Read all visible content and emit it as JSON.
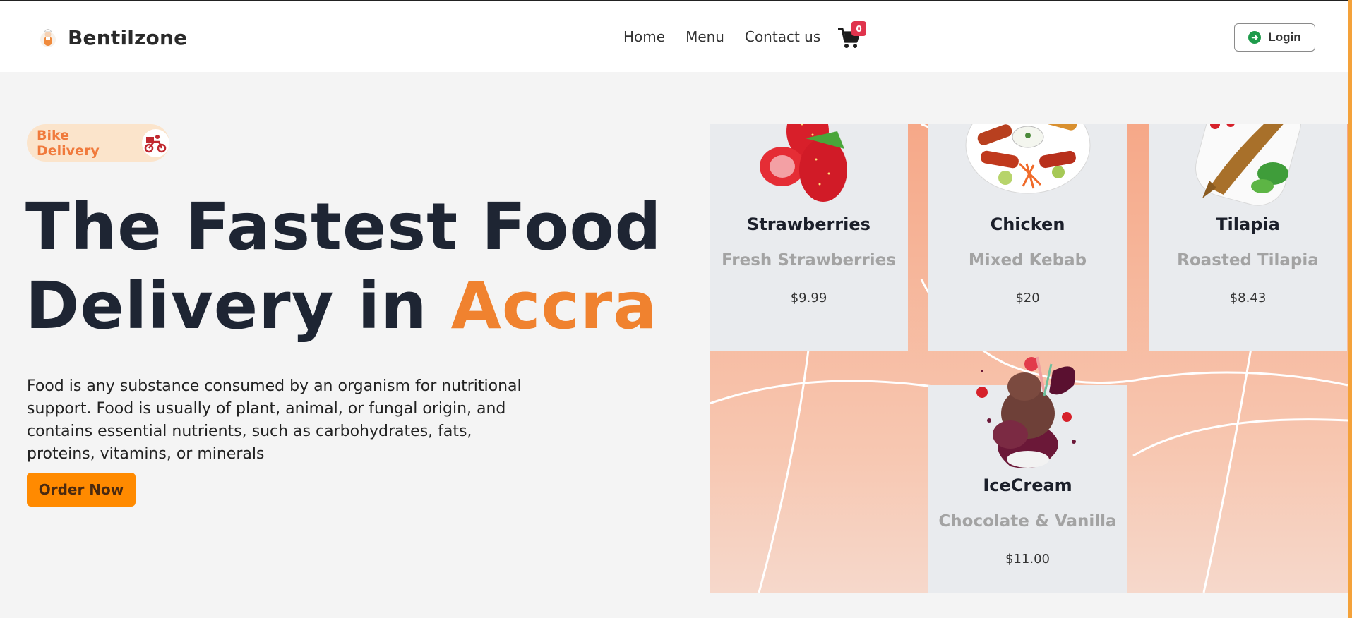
{
  "header": {
    "brand": "Bentilzone",
    "nav": [
      "Home",
      "Menu",
      "Contact us"
    ],
    "cart_count": "0",
    "login_label": "Login"
  },
  "hero": {
    "badge_label": "Bike Delivery",
    "headline_part1": "The Fastest Food",
    "headline_part2": "Delivery in ",
    "headline_accent": "Accra",
    "description": "Food is any substance consumed by an organism for nutritional support. Food is usually of plant, animal, or fungal origin, and contains essential nutrients, such as carbohydrates, fats, proteins, vitamins, or minerals",
    "order_label": "Order Now"
  },
  "cards": [
    {
      "title": "Strawberries",
      "subtitle": "Fresh Strawberries",
      "price": "$9.99"
    },
    {
      "title": "Chicken",
      "subtitle": "Mixed Kebab",
      "price": "$20"
    },
    {
      "title": "Tilapia",
      "subtitle": "Roasted Tilapia",
      "price": "$8.43"
    },
    {
      "title": "IceCream",
      "subtitle": "Chocolate & Vanilla",
      "price": "$11.00"
    }
  ],
  "colors": {
    "accent": "#f0822f",
    "order_button": "#ff8a00",
    "badge_bg": "#fbe4cb",
    "cart_badge": "#e0344d",
    "panel_peach": "#f6a888"
  },
  "icons": [
    "chef-logo-icon",
    "cart-icon",
    "login-arrow-icon",
    "bike-delivery-icon",
    "strawberries-image",
    "kebab-image",
    "tilapia-image",
    "icecream-image"
  ]
}
